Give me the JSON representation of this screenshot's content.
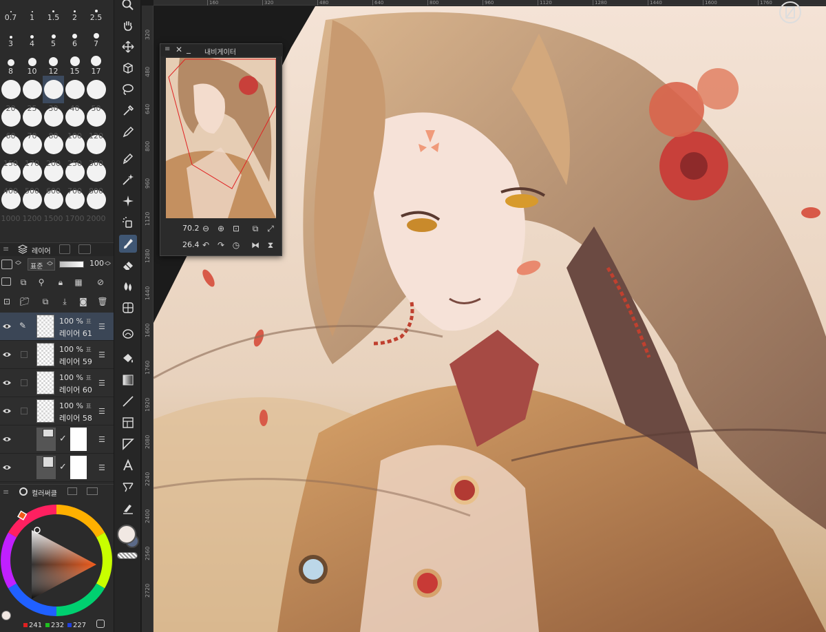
{
  "brush_sizes": {
    "row1": [
      "0.7",
      "1",
      "1.5",
      "2",
      "2.5"
    ],
    "row2": [
      "3",
      "4",
      "5",
      "6",
      "7"
    ],
    "row3": [
      "8",
      "10",
      "12",
      "15",
      "17"
    ],
    "row4": [
      "20",
      "25",
      "30",
      "40",
      "50"
    ],
    "row5": [
      "60",
      "70",
      "80",
      "100",
      "120"
    ],
    "row6": [
      "150",
      "170",
      "200",
      "250",
      "300"
    ],
    "row7": [
      "400",
      "500",
      "600",
      "700",
      "800"
    ],
    "row8": [
      "1000",
      "1200",
      "1500",
      "1700",
      "2000"
    ],
    "selected": "30"
  },
  "layer_panel": {
    "tab_label": "레이어",
    "blend_mode": "표준",
    "opacity": "100",
    "layers": [
      {
        "opacity": "100 %",
        "mode": "표",
        "name": "레이어 61"
      },
      {
        "opacity": "100 %",
        "mode": "표",
        "name": "레이어 59"
      },
      {
        "opacity": "100 %",
        "mode": "표",
        "name": "레이어 60"
      },
      {
        "opacity": "100 %",
        "mode": "표",
        "name": "레이어 58"
      }
    ]
  },
  "color_panel": {
    "tab_label": "컬러써클",
    "r": "241",
    "g": "232",
    "b": "227"
  },
  "navigator": {
    "title": "내비게이터",
    "zoom": "70.2",
    "rotation": "26.4"
  },
  "ruler": {
    "top": [
      "160",
      "320",
      "480",
      "640",
      "800",
      "960",
      "1120",
      "1280",
      "1440",
      "1600",
      "1760"
    ],
    "left": [
      "320",
      "480",
      "640",
      "800",
      "960",
      "1120",
      "1280",
      "1440",
      "1600",
      "1760",
      "1920",
      "2080",
      "2240",
      "2400",
      "2560",
      "2720"
    ]
  },
  "colors": {
    "panel_bg": "#2b2b2b",
    "selected_accent": "#3f5673",
    "main_color": "#f1e8e3"
  }
}
